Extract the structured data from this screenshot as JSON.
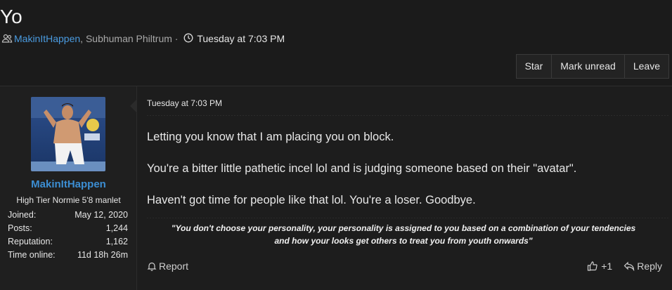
{
  "thread": {
    "title": "Yo",
    "participants_link": "MakinItHappen",
    "participants_rest": ", Subhuman Philtrum",
    "separator": " · ",
    "time": "Tuesday at 7:03 PM"
  },
  "actions": [
    {
      "label": "Star"
    },
    {
      "label": "Mark unread"
    },
    {
      "label": "Leave"
    }
  ],
  "post": {
    "user": {
      "name": "MakinItHappen",
      "title": "High Tier Normie 5'8 manlet",
      "stats": [
        {
          "label": "Joined:",
          "value": "May 12, 2020"
        },
        {
          "label": "Posts:",
          "value": "1,244"
        },
        {
          "label": "Reputation:",
          "value": "1,162"
        },
        {
          "label": "Time online:",
          "value": "11d 18h 26m"
        }
      ]
    },
    "date": "Tuesday at 7:03 PM",
    "paragraphs": [
      "Letting you know that I am placing you on block.",
      "You're a bitter little pathetic incel lol and is judging someone based on their \"avatar\".",
      "Haven't got time for people like that lol. You're a loser. Goodbye."
    ],
    "signature_line1": "\"You don't choose your personality, your personality is assigned to you based on a combination of your tendencies",
    "signature_line2": "and how your looks get others to treat you from youth onwards\"",
    "report_label": "Report",
    "like_count": "+1",
    "reply_label": "Reply"
  },
  "icons": {
    "participants": "users-icon",
    "clock": "clock-icon",
    "report": "bell-icon",
    "like": "thumbs-up-icon",
    "reply": "reply-arrow-icon"
  },
  "colors": {
    "background": "#1b1b1b",
    "link": "#4a9be0",
    "username": "#3c8ed3"
  }
}
